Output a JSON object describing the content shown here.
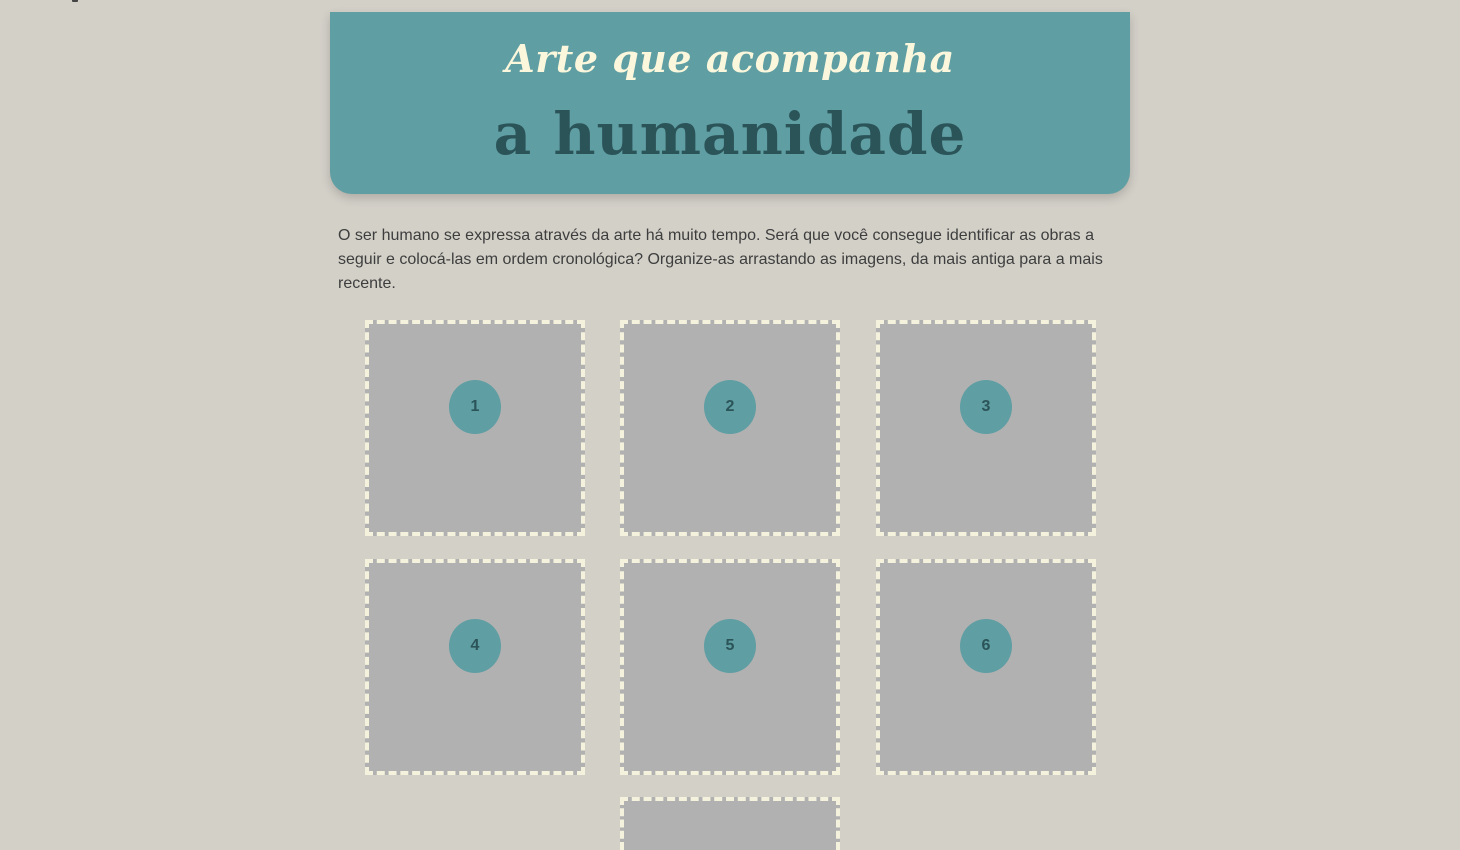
{
  "header": {
    "title_line1": "Arte que acompanha",
    "title_line2": "a humanidade"
  },
  "intro": {
    "text": "O ser humano se expressa através da arte há muito tempo. Será que você consegue identificar as obras a seguir e colocá-las em ordem cronológica? Organize-as arrastando as imagens, da mais antiga para a mais recente."
  },
  "slots": [
    {
      "label": "1"
    },
    {
      "label": "2"
    },
    {
      "label": "3"
    },
    {
      "label": "4"
    },
    {
      "label": "5"
    },
    {
      "label": "6"
    },
    {
      "label": ""
    }
  ],
  "colors": {
    "background": "#d3d0c8",
    "header": "#5f9ea3",
    "title_light": "#fbf7dc",
    "title_dark": "#2b5459",
    "slot_fill": "#b1b1b1",
    "slot_border": "#f4f1dc"
  }
}
